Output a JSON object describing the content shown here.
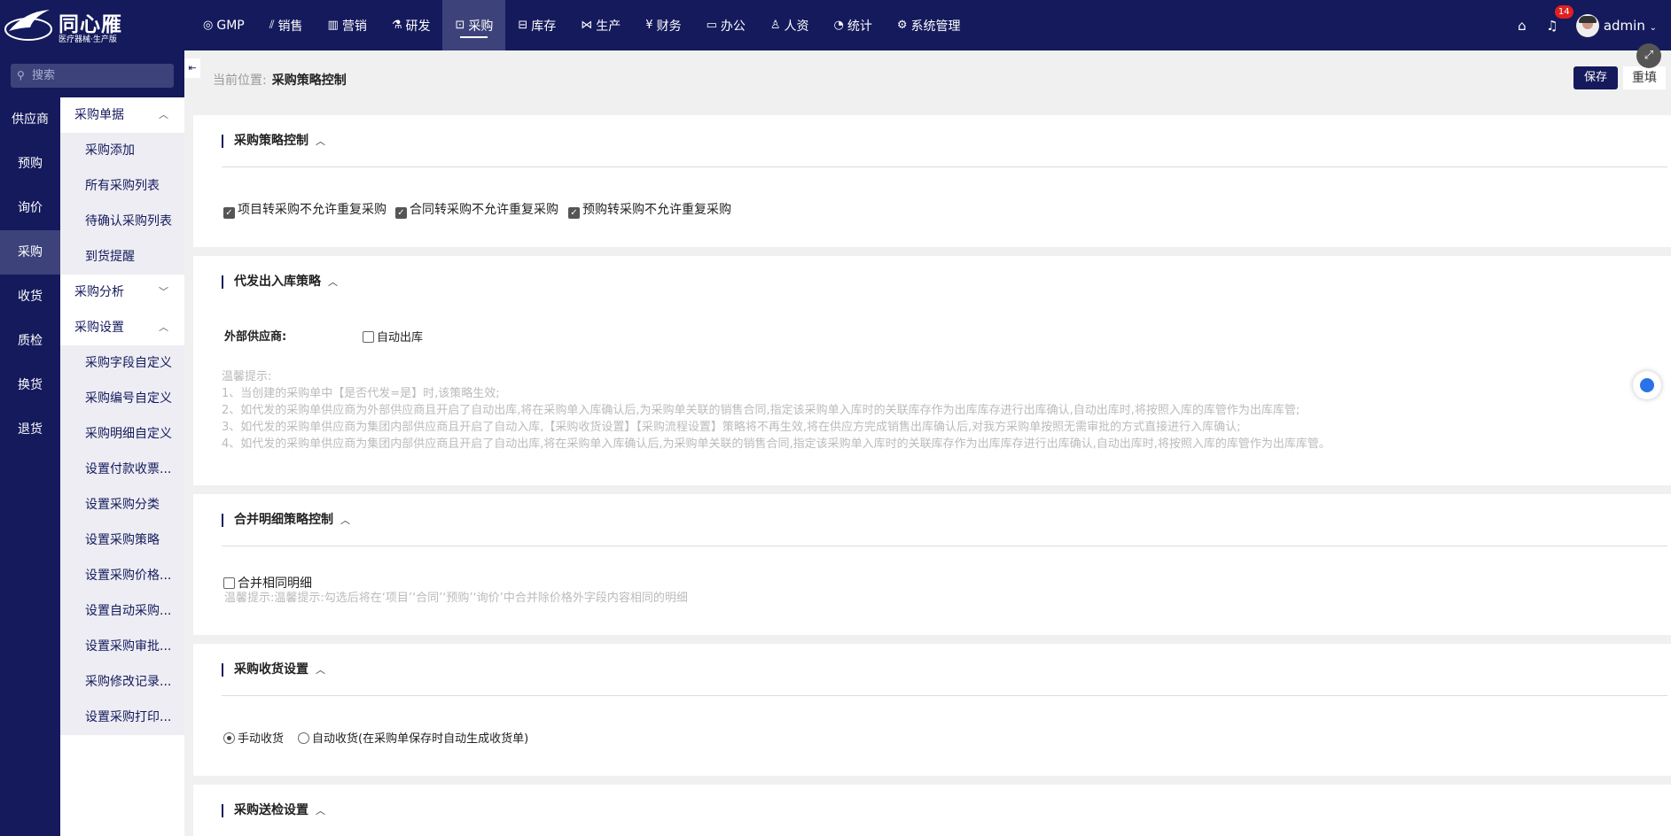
{
  "brand": {
    "name": "同心雁",
    "subtitle": "医疗器械·生产版"
  },
  "nav": [
    {
      "label": "GMP",
      "icon": "gmp-icon"
    },
    {
      "label": "销售",
      "icon": "chart-icon"
    },
    {
      "label": "营销",
      "icon": "bar-chart-icon"
    },
    {
      "label": "研发",
      "icon": "lab-icon"
    },
    {
      "label": "采购",
      "icon": "basket-icon",
      "active": true
    },
    {
      "label": "库存",
      "icon": "warehouse-icon"
    },
    {
      "label": "生产",
      "icon": "production-icon"
    },
    {
      "label": "财务",
      "icon": "yen-icon"
    },
    {
      "label": "办公",
      "icon": "briefcase-icon"
    },
    {
      "label": "人资",
      "icon": "user-icon"
    },
    {
      "label": "统计",
      "icon": "pie-icon"
    },
    {
      "label": "系统管理",
      "icon": "gear-icon"
    }
  ],
  "user": {
    "name": "admin",
    "notifications": "14"
  },
  "search": {
    "placeholder": "搜索"
  },
  "categories": [
    "供应商",
    "预购",
    "询价",
    "采购",
    "收货",
    "质检",
    "换货",
    "退货"
  ],
  "submenu": {
    "g1": "采购单据",
    "g1_items": [
      "采购添加",
      "所有采购列表",
      "待确认采购列表",
      "到货提醒"
    ],
    "g2": "采购分析",
    "g3": "采购设置",
    "g3_items": [
      "采购字段自定义",
      "采购编号自定义",
      "采购明细自定义",
      "设置付款收票...",
      "设置采购分类",
      "设置采购策略",
      "设置采购价格...",
      "设置自动采购...",
      "设置采购审批...",
      "采购修改记录...",
      "设置采购打印..."
    ]
  },
  "breadcrumb": {
    "label": "当前位置:",
    "current": "采购策略控制"
  },
  "actions": {
    "save": "保存",
    "reset": "重填"
  },
  "panels": {
    "p1": {
      "title": "采购策略控制",
      "options": [
        "项目转采购不允许重复采购",
        "合同转采购不允许重复采购",
        "预购转采购不允许重复采购"
      ]
    },
    "p2": {
      "title": "代发出入库策略",
      "field_label": "外部供应商:",
      "option": "自动出库",
      "hints": [
        "温馨提示:",
        "1、当创建的采购单中【是否代发=是】时,该策略生效;",
        "2、如代发的采购单供应商为外部供应商且开启了自动出库,将在采购单入库确认后,为采购单关联的销售合同,指定该采购单入库时的关联库存作为出库库存进行出库确认,自动出库时,将按照入库的库管作为出库库管;",
        "3、如代发的采购单供应商为集团内部供应商且开启了自动入库,【采购收货设置】【采购流程设置】策略将不再生效,将在供应方完成销售出库确认后,对我方采购单按照无需审批的方式直接进行入库确认;",
        "4、如代发的采购单供应商为集团内部供应商且开启了自动出库,将在采购单入库确认后,为采购单关联的销售合同,指定该采购单入库时的关联库存作为出库库存进行出库确认,自动出库时,将按照入库的库管作为出库库管。"
      ]
    },
    "p3": {
      "title": "合并明细策略控制",
      "option": "合并相同明细",
      "hint": "温馨提示:温馨提示:勾选后将在‘项目’‘合同’‘预购’‘询价’中合并除价格外字段内容相同的明细"
    },
    "p4": {
      "title": "采购收货设置",
      "options": [
        "手动收货",
        "自动收货(在采购单保存时自动生成收货单)"
      ]
    },
    "p5": {
      "title": "采购送检设置"
    }
  }
}
